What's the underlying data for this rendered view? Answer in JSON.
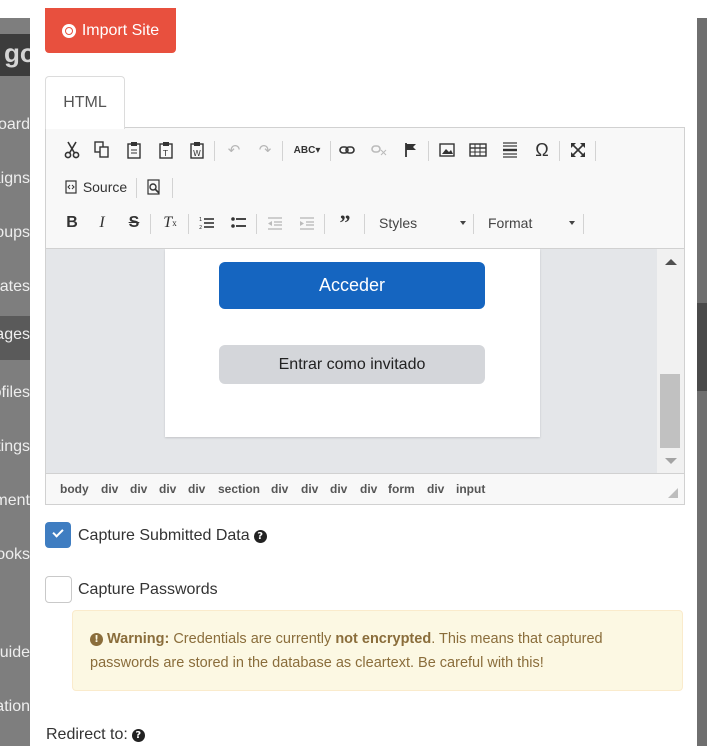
{
  "sidebar": {
    "brand": "go",
    "items": [
      {
        "label": "Dashboard",
        "active": false
      },
      {
        "label": "Campaigns",
        "active": false
      },
      {
        "label": "Users & Groups",
        "active": false
      },
      {
        "label": "Email Templates",
        "active": false
      },
      {
        "label": "Landing Pages",
        "active": true
      },
      {
        "label": "Sending Profiles",
        "active": false
      },
      {
        "label": "Account Settings",
        "active": false
      },
      {
        "label": "User Management",
        "active": false
      },
      {
        "label": "Webhooks",
        "active": false
      },
      {
        "label": "User Guide",
        "active": false
      },
      {
        "label": "API Documentation",
        "active": false
      }
    ]
  },
  "modal": {
    "import_button": "Import Site",
    "tab_html": "HTML",
    "editor": {
      "toolbar": {
        "source_label": "Source",
        "styles_label": "Styles",
        "format_label": "Format",
        "icons": [
          "cut-icon",
          "copy-icon",
          "paste-icon",
          "paste-text-icon",
          "paste-word-icon",
          "undo-icon",
          "redo-icon",
          "spellcheck-icon",
          "link-icon",
          "unlink-icon",
          "anchor-icon",
          "image-icon",
          "table-icon",
          "horizontal-rule-icon",
          "special-char-icon",
          "maximize-icon",
          "source-icon",
          "preview-icon",
          "bold-icon",
          "italic-icon",
          "strike-icon",
          "remove-format-icon",
          "numbered-list-icon",
          "bulleted-list-icon",
          "decrease-indent-icon",
          "increase-indent-icon",
          "blockquote-icon"
        ]
      },
      "preview": {
        "primary_button": "Acceder",
        "secondary_button": "Entrar como invitado"
      },
      "element_path": [
        "body",
        "div",
        "div",
        "div",
        "div",
        "section",
        "div",
        "div",
        "div",
        "div",
        "form",
        "div",
        "input"
      ]
    },
    "capture_data": {
      "label": "Capture Submitted Data",
      "checked": true
    },
    "capture_passwords": {
      "label": "Capture Passwords",
      "checked": false
    },
    "warning": {
      "strong": "Warning:",
      "text1": " Credentials are currently ",
      "strong2": "not encrypted",
      "text2": ". This means that captured passwords are stored in the database as cleartext. Be careful with this!"
    },
    "redirect_label": "Redirect to:"
  },
  "colors": {
    "import_button": "#e8503e",
    "primary_button": "#1565c0",
    "checkbox_checked": "#3f7dc1",
    "warning_bg": "#fcf8e3"
  }
}
